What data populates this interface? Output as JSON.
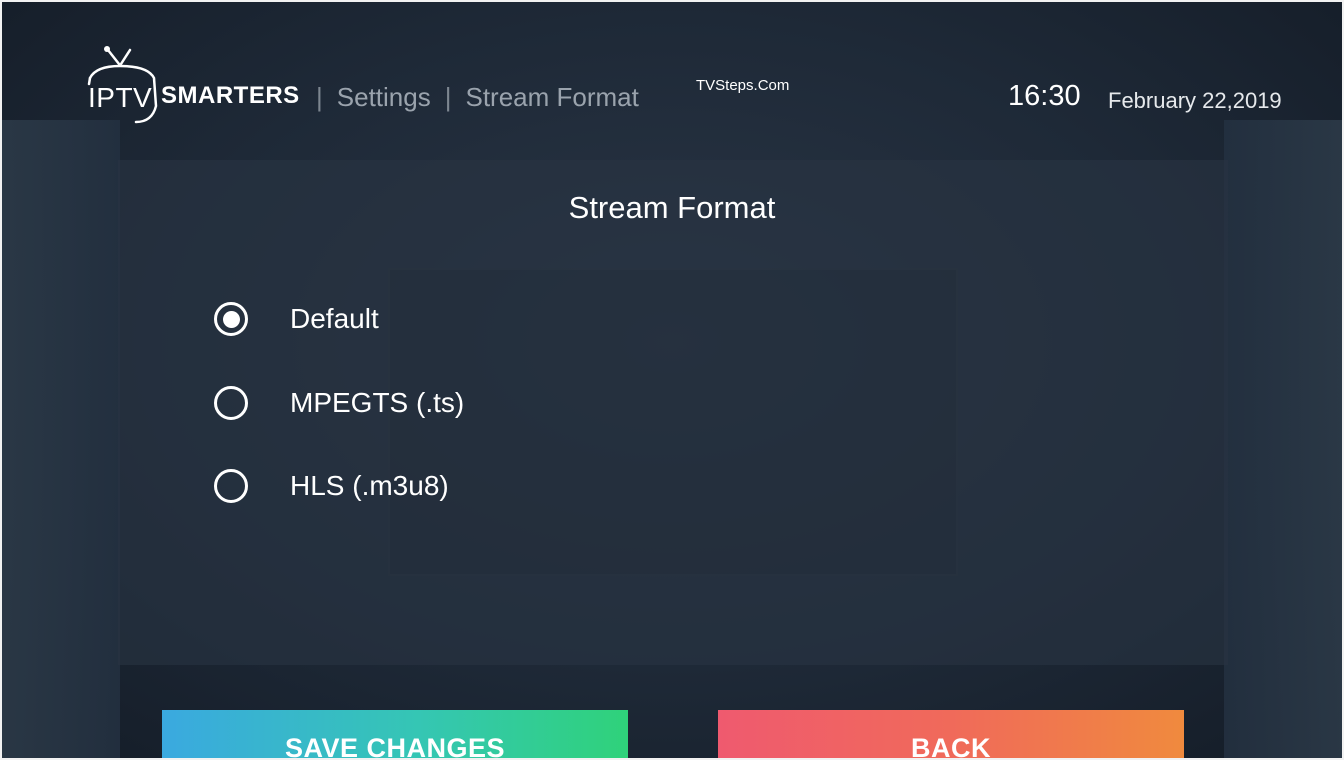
{
  "header": {
    "logo": {
      "iptv_text": "IPTV",
      "smarters_text": "SMARTERS"
    },
    "breadcrumb": {
      "separator": "|",
      "items": [
        "Settings",
        "Stream Format"
      ]
    },
    "watermark": "TVSteps.Com",
    "time": "16:30",
    "date": "February 22,2019"
  },
  "panel": {
    "title": "Stream Format",
    "options": [
      {
        "label": "Default",
        "selected": true
      },
      {
        "label": "MPEGTS (.ts)",
        "selected": false
      },
      {
        "label": "HLS (.m3u8)",
        "selected": false
      }
    ]
  },
  "buttons": {
    "save_label": "SAVE CHANGES",
    "back_label": "BACK"
  },
  "colors": {
    "save_gradient_start": "#3aa9e0",
    "save_gradient_end": "#2fd27a",
    "back_gradient_start": "#ef5a6f",
    "back_gradient_end": "#f08a3e"
  }
}
